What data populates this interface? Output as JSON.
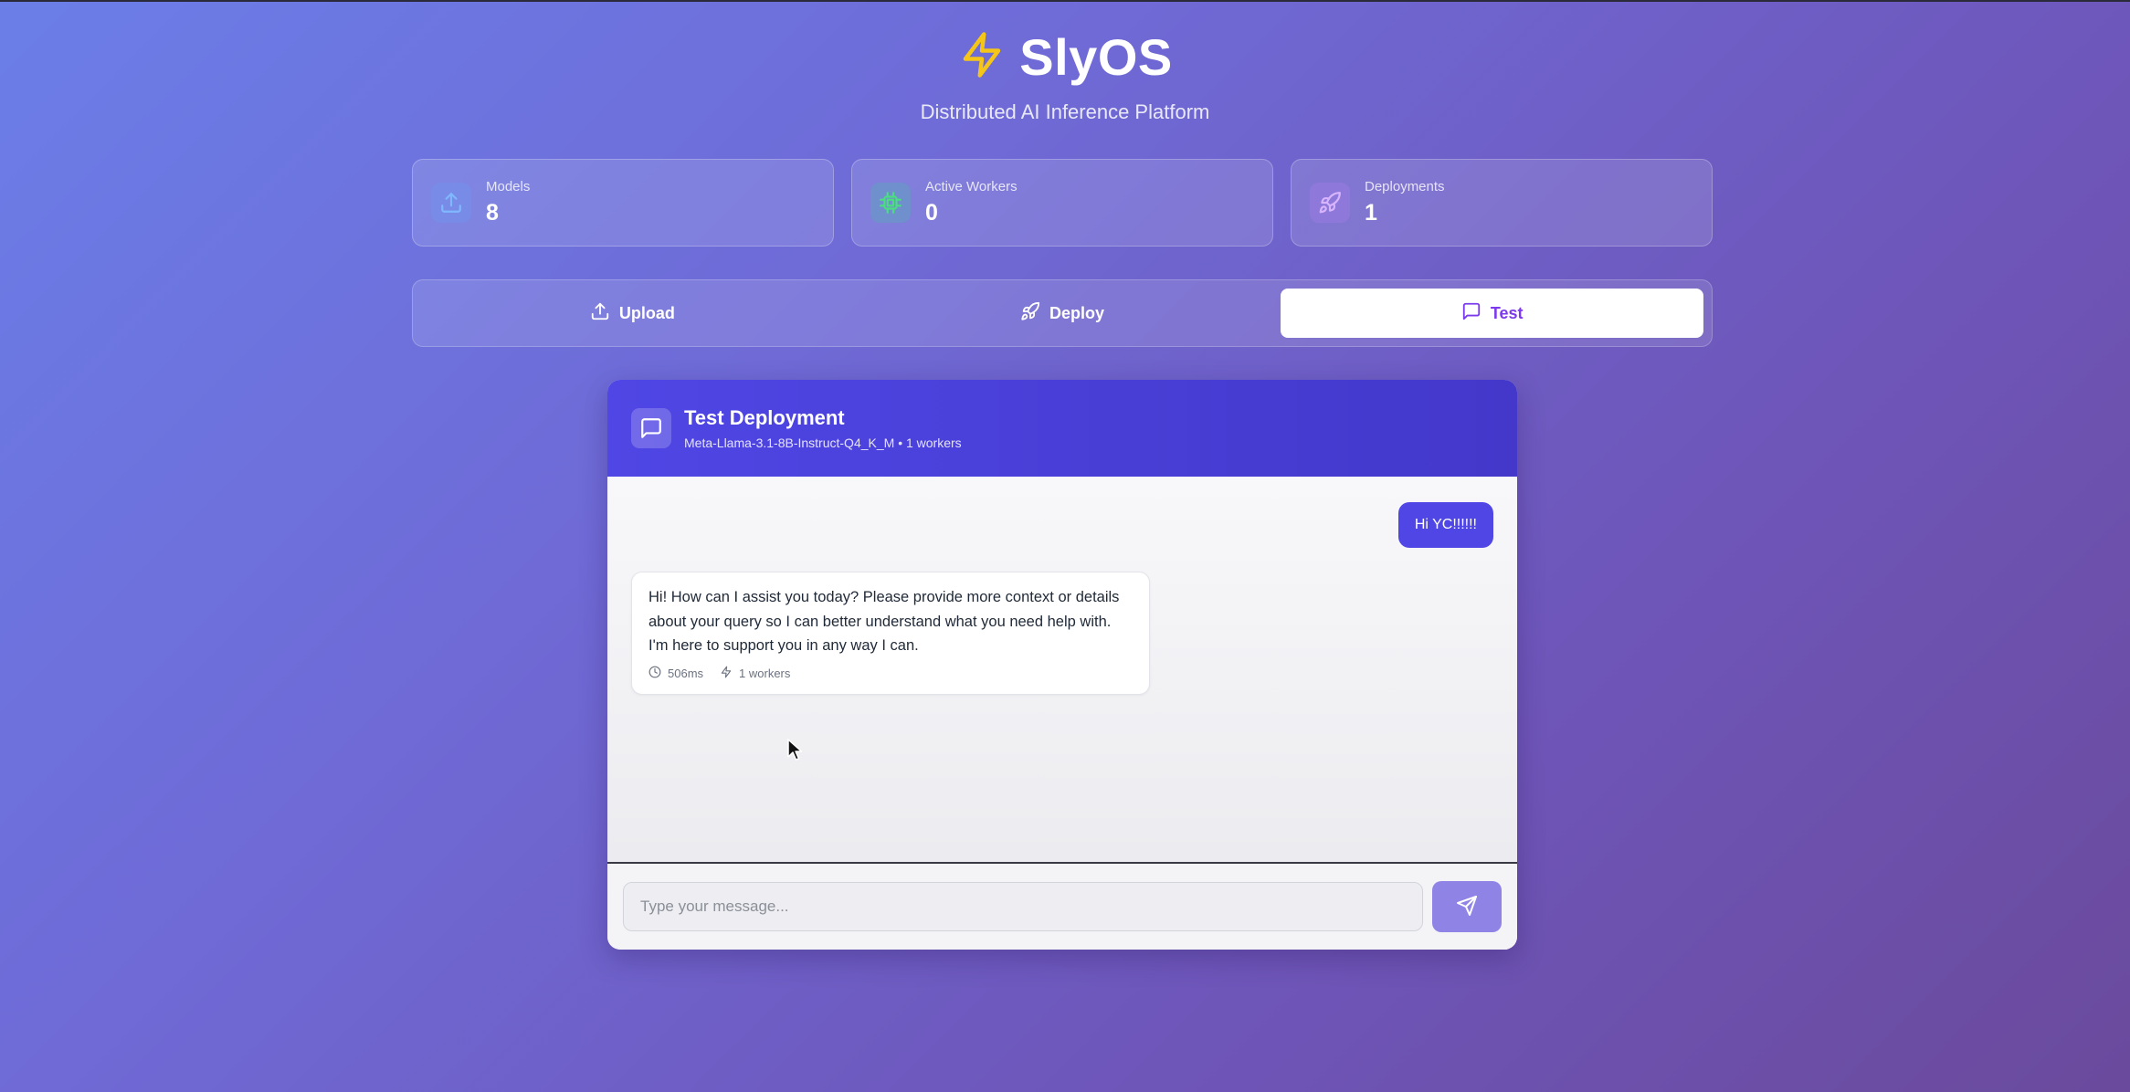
{
  "app": {
    "name": "SlyOS",
    "subtitle": "Distributed AI Inference Platform",
    "logo_icon": "lightning-bolt-icon",
    "accent_color": "#4f46e5",
    "logo_color": "#f5c518"
  },
  "stats": [
    {
      "label": "Models",
      "value": "8",
      "icon": "upload-icon",
      "icon_color": "#60a5fa"
    },
    {
      "label": "Active Workers",
      "value": "0",
      "icon": "cpu-chip-icon",
      "icon_color": "#34d399"
    },
    {
      "label": "Deployments",
      "value": "1",
      "icon": "rocket-icon",
      "icon_color": "#c084fc"
    }
  ],
  "tabs": [
    {
      "label": "Upload",
      "icon": "upload-icon",
      "active": false
    },
    {
      "label": "Deploy",
      "icon": "rocket-icon",
      "active": false
    },
    {
      "label": "Test",
      "icon": "message-square-icon",
      "active": true
    }
  ],
  "panel": {
    "title": "Test Deployment",
    "subtitle": "Meta-Llama-3.1-8B-Instruct-Q4_K_M • 1 workers",
    "icon": "message-square-icon"
  },
  "messages": [
    {
      "role": "user",
      "text": "Hi YC!!!!!!"
    },
    {
      "role": "assistant",
      "text": "Hi! How can I assist you today?  Please provide more context or details about your query so I can better understand what you need help with. I'm here to support you in any way I can.",
      "latency": "506ms",
      "workers": "1 workers"
    }
  ],
  "composer": {
    "placeholder": "Type your message...",
    "value": "",
    "send_icon": "send-icon"
  }
}
